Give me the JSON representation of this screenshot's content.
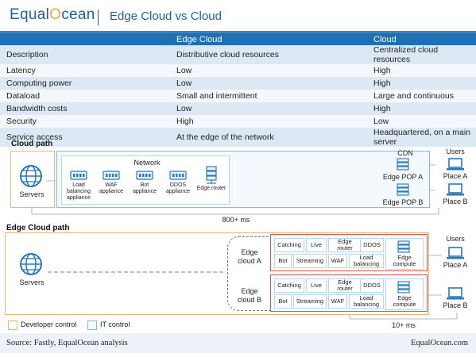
{
  "header": {
    "logo_left": "Equal",
    "logo_o": "O",
    "logo_right": "cean",
    "title": "Edge Cloud vs Cloud"
  },
  "table": {
    "columns": [
      "",
      "Edge Cloud",
      "Cloud"
    ],
    "rows": [
      [
        "Description",
        "Distributive cloud resources",
        "Centralized cloud resources"
      ],
      [
        "Latency",
        "Low",
        "High"
      ],
      [
        "Computing power",
        "Low",
        "High"
      ],
      [
        "Dataload",
        "Small and intermittent",
        "Large and continuous"
      ],
      [
        "Bandwidth costs",
        "Low",
        "High"
      ],
      [
        "Security",
        "High",
        "Low"
      ],
      [
        "Service access",
        "At the edge of the network",
        "Headquartered, on a main server"
      ]
    ]
  },
  "cloud_path": {
    "title": "Cloud path",
    "servers": "Servers",
    "network": "Network",
    "appliances": [
      {
        "label": "Load balancing appliance"
      },
      {
        "label": "WAF appliance"
      },
      {
        "label": "Bot appliance"
      },
      {
        "label": "DDOS appliance"
      },
      {
        "label": "Edge router"
      }
    ],
    "cdn": "CDN",
    "pop_a": "Edge POP A",
    "pop_b": "Edge POP B",
    "users": "Users",
    "place_a": "Place A",
    "place_b": "Place B",
    "latency": "800+ ms"
  },
  "edge_path": {
    "title": "Edge Cloud path",
    "servers": "Servers",
    "cloud_a": "Edge cloud A",
    "cloud_b": "Edge cloud B",
    "services": {
      "catching": "Catching",
      "live": "Live",
      "edge_router": "Edge router",
      "ddos": "DDOS",
      "bot": "Bot",
      "streaming": "Streaming",
      "waf": "WAF",
      "load_balancing": "Load balancing",
      "edge_compute": "Edge compute"
    },
    "users": "Users",
    "place_a": "Place A",
    "place_b": "Place B",
    "latency": "10+ ms"
  },
  "legend": {
    "developer": "Developer control",
    "it": "IT control",
    "developer_color": "#e8b778",
    "it_color": "#7fbbe2"
  },
  "footer": {
    "source": "Source: Fastly, EqualOcean analysis",
    "site": "EqualOcean.com"
  }
}
